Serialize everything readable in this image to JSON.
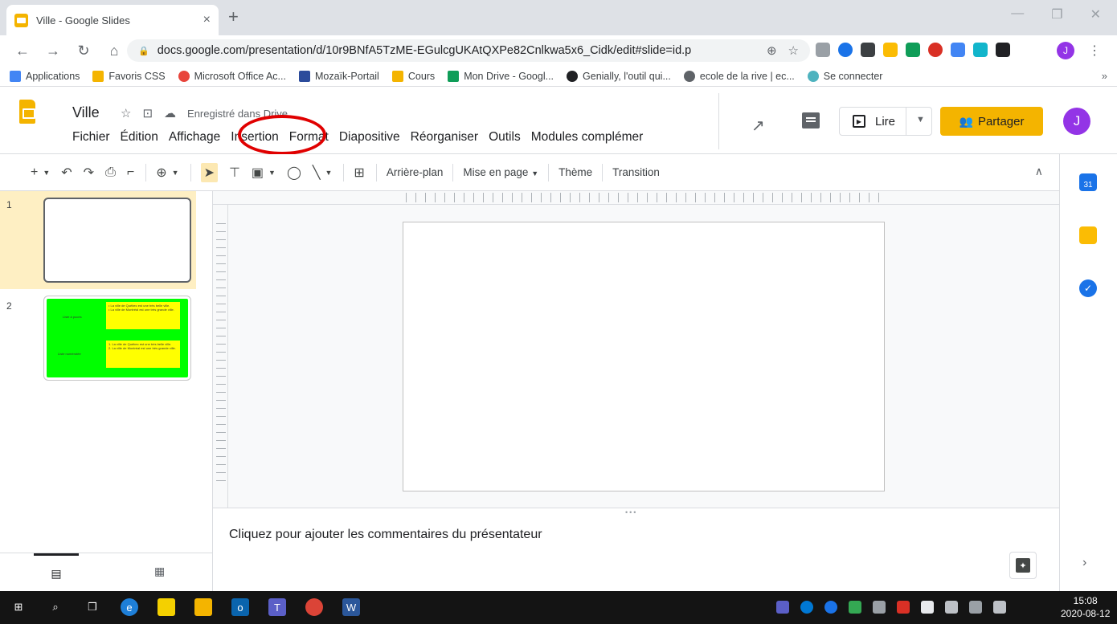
{
  "browser": {
    "tab_title": "Ville - Google Slides",
    "tab_close": "×",
    "new_tab": "+",
    "url": "docs.google.com/presentation/d/10r9BNfA5TzME-EGulcgUKAtQXPe82Cnlkwa5x6_Cidk/edit#slide=id.p",
    "profile_initial": "J",
    "bookmarks": [
      {
        "label": "Applications",
        "color": "#4285f4"
      },
      {
        "label": "Favoris CSS",
        "color": "#f4b400"
      },
      {
        "label": "Microsoft Office Ac...",
        "color": "#e8453c"
      },
      {
        "label": "Mozaïk-Portail",
        "color": "#2b4b9b"
      },
      {
        "label": "Cours",
        "color": "#f4b400"
      },
      {
        "label": "Mon Drive - Googl...",
        "color": "#0f9d58"
      },
      {
        "label": "Genially, l'outil qui...",
        "color": "#202124"
      },
      {
        "label": "ecole de la rive | ec...",
        "color": "#5f6368"
      },
      {
        "label": "Se connecter",
        "color": "#4fb3bf"
      }
    ],
    "bookmarks_more": "»"
  },
  "app": {
    "doc_title": "Ville",
    "saved_status": "Enregistré dans Drive",
    "menus": [
      "Fichier",
      "Édition",
      "Affichage",
      "Insertion",
      "Format",
      "Diapositive",
      "Réorganiser",
      "Outils",
      "Modules complémer"
    ],
    "present_label": "Lire",
    "share_label": "Partager",
    "user_initial": "J"
  },
  "toolbar": {
    "background": "Arrière-plan",
    "layout": "Mise en page",
    "theme": "Thème",
    "transition": "Transition"
  },
  "filmstrip": {
    "slides": [
      {
        "number": "1"
      },
      {
        "number": "2",
        "label_a": "Liste à puces",
        "label_b": "Liste numérotée",
        "bullets": [
          "La ville de Québec est une très belle ville.",
          "La ville de Montréal est une très grande ville."
        ],
        "numbered": [
          "La ville de Québec est une très belle ville.",
          "La ville de Montréal est une très grande ville."
        ]
      }
    ]
  },
  "notes": {
    "placeholder": "Cliquez pour ajouter les commentaires du présentateur"
  },
  "side_panel": {
    "calendar_day": "31"
  },
  "taskbar": {
    "time": "15:08",
    "date": "2020-08-12"
  },
  "colors": {
    "accent": "#f4b400",
    "highlight_circle": "#e00000",
    "slide2_bg": "#00ff00",
    "slide2_box": "#ffff00"
  }
}
